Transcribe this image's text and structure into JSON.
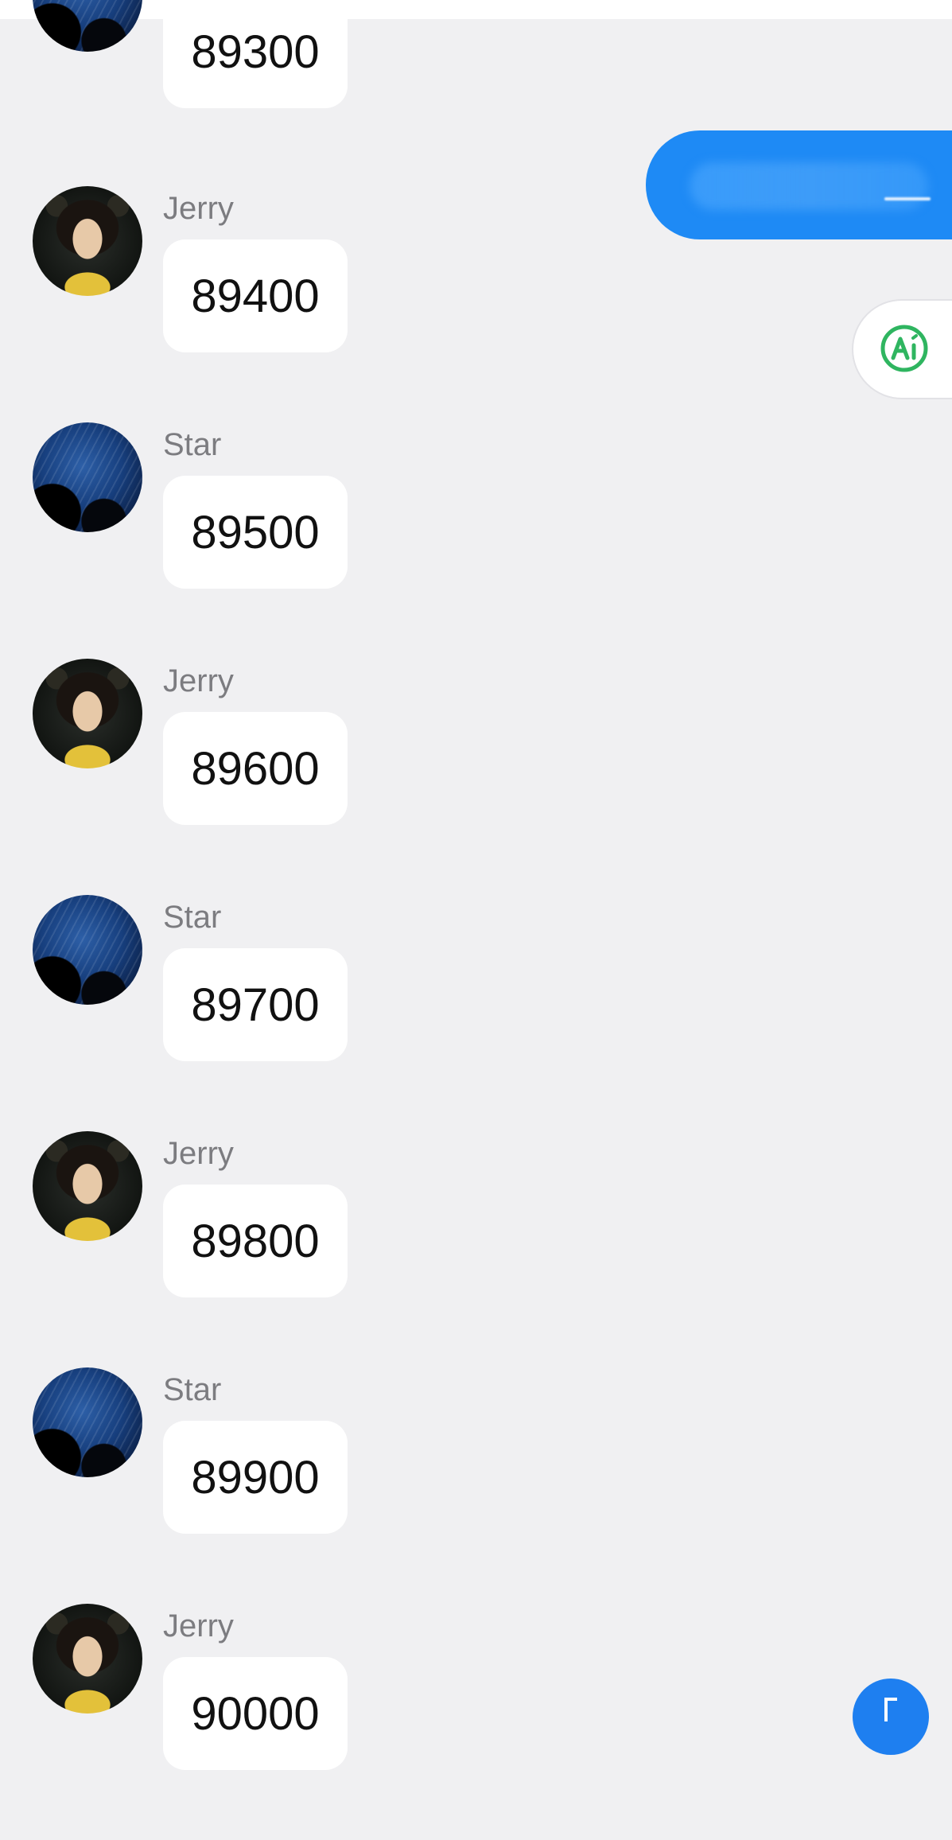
{
  "messages": [
    {
      "sender": "",
      "avatar": "star",
      "text": "89300"
    },
    {
      "sender": "Jerry",
      "avatar": "jerry",
      "text": "89400"
    },
    {
      "sender": "Star",
      "avatar": "star",
      "text": "89500"
    },
    {
      "sender": "Jerry",
      "avatar": "jerry",
      "text": "89600"
    },
    {
      "sender": "Star",
      "avatar": "star",
      "text": "89700"
    },
    {
      "sender": "Jerry",
      "avatar": "jerry",
      "text": "89800"
    },
    {
      "sender": "Star",
      "avatar": "star",
      "text": "89900"
    },
    {
      "sender": "Jerry",
      "avatar": "jerry",
      "text": "90000"
    }
  ],
  "colors": {
    "background": "#f0f0f2",
    "outgoing_bubble": "#1e8af5",
    "ai_icon": "#2fb560",
    "fab": "#1e7ff0"
  },
  "icons": {
    "ai_button": "ai-icon",
    "fab": "bracket-icon"
  }
}
